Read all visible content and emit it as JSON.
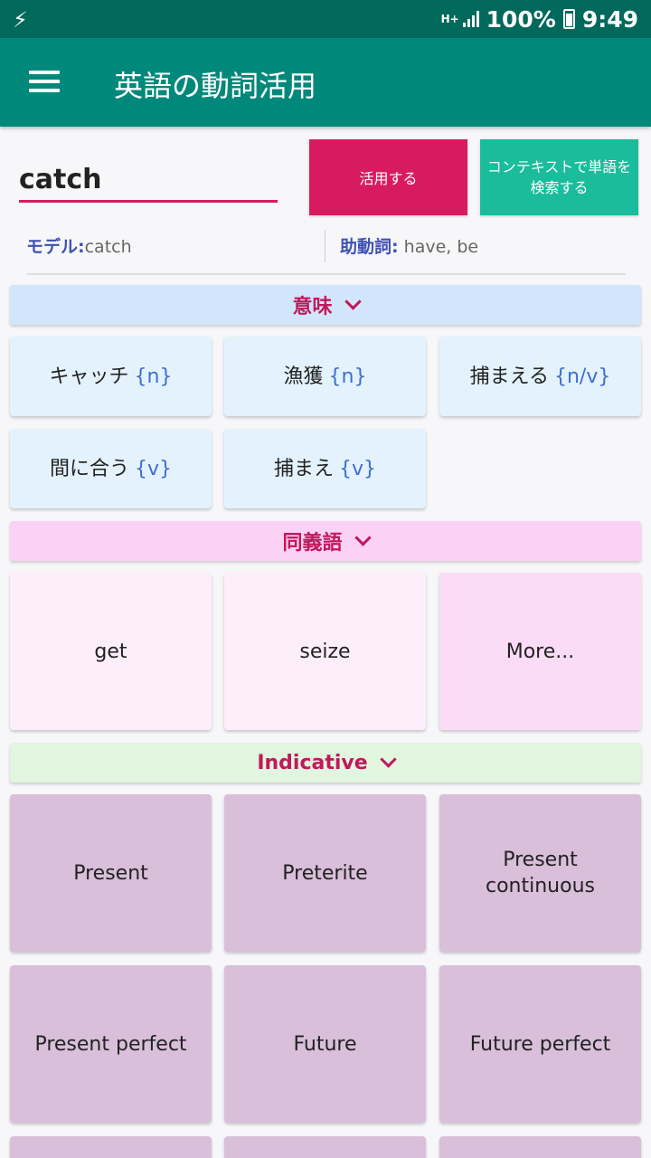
{
  "status_bar": {
    "network": "H+",
    "battery": "100%",
    "time": "9:49"
  },
  "app_bar": {
    "title": "英語の動詞活用"
  },
  "search": {
    "verb": "catch",
    "conjugate_label": "活用する",
    "context_label": "コンテキストで単語を検索する"
  },
  "info": {
    "model_label": "モデル:",
    "model_value": "catch",
    "aux_label": "助動詞:",
    "aux_value": "have, be"
  },
  "sections": {
    "meanings": {
      "title": "意味",
      "color": "#d2e6fb"
    },
    "synonyms": {
      "title": "同義語",
      "color": "#fbd2f6"
    },
    "indicative": {
      "title": "Indicative",
      "color": "#e1f5df"
    }
  },
  "meanings": [
    {
      "word": "キャッチ",
      "tag": "{n}"
    },
    {
      "word": "漁獲",
      "tag": "{n}"
    },
    {
      "word": "捕まえる",
      "tag": "{n/v}"
    },
    {
      "word": "間に合う",
      "tag": "{v}"
    },
    {
      "word": "捕まえ",
      "tag": "{v}"
    }
  ],
  "synonyms": [
    "get",
    "seize",
    "More..."
  ],
  "tenses": [
    "Present",
    "Preterite",
    "Present continuous",
    "Present perfect",
    "Future",
    "Future perfect"
  ],
  "colors": {
    "status_bar": "#00695c",
    "app_bar": "#00897b",
    "accent_pink": "#d81b60",
    "accent_teal": "#1abc9c",
    "tag_blue": "#3f6fd0"
  }
}
